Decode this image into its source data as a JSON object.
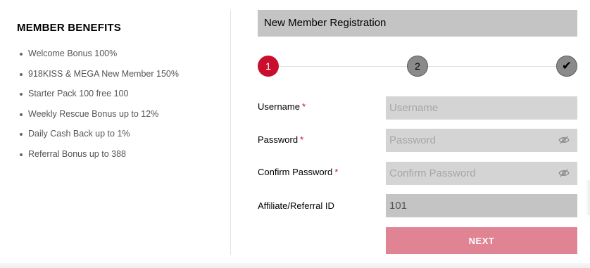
{
  "benefits": {
    "title": "MEMBER BENEFITS",
    "items": [
      "Welcome Bonus 100%",
      "918KISS & MEGA New Member 150%",
      "Starter Pack 100 free 100",
      "Weekly Rescue Bonus up to 12%",
      "Daily Cash Back up to 1%",
      "Referral Bonus up to 388"
    ]
  },
  "form": {
    "header": "New Member Registration",
    "steps": [
      "1",
      "2",
      "✔"
    ],
    "current_step": 1,
    "fields": {
      "username": {
        "label": "Username",
        "required_mark": "*",
        "placeholder": "Username",
        "value": ""
      },
      "password": {
        "label": "Password",
        "required_mark": "*",
        "placeholder": "Password",
        "value": ""
      },
      "confirm_password": {
        "label": "Confirm Password",
        "required_mark": "*",
        "placeholder": "Confirm Password",
        "value": ""
      },
      "referral": {
        "label": "Affiliate/Referral ID",
        "value": "101"
      }
    },
    "next_label": "NEXT"
  },
  "colors": {
    "accent": "#c8102e",
    "next_button": "#e08393",
    "header_bar": "#c4c4c4",
    "input_bg": "#d4d4d4"
  },
  "icons": {
    "password_toggle": "eye-off-icon",
    "bullet": "bullet-icon"
  }
}
